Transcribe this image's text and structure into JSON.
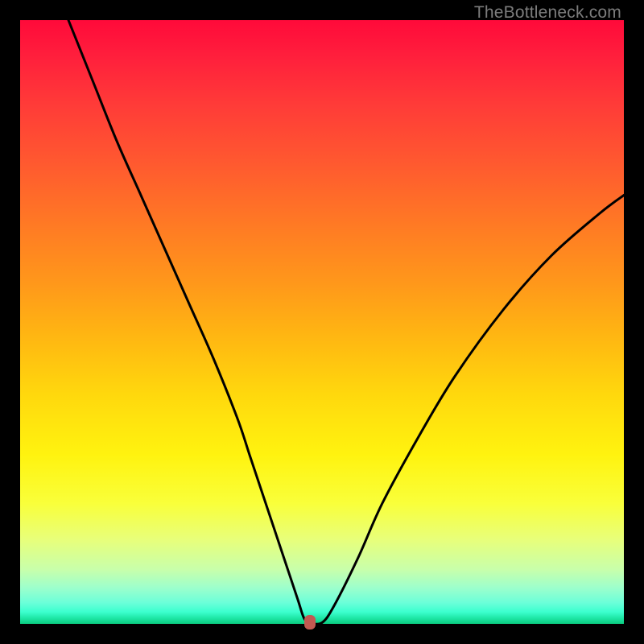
{
  "watermark": "TheBottleneck.com",
  "chart_data": {
    "type": "line",
    "title": "",
    "xlabel": "",
    "ylabel": "",
    "xlim": [
      0,
      100
    ],
    "ylim": [
      0,
      100
    ],
    "grid": false,
    "legend": false,
    "series": [
      {
        "name": "curve",
        "color": "#000000",
        "x": [
          8,
          12,
          16,
          20,
          24,
          28,
          32,
          36,
          38,
          40,
          42,
          44,
          46,
          47,
          48,
          50,
          52,
          56,
          60,
          66,
          72,
          80,
          88,
          96,
          100
        ],
        "y": [
          100,
          90,
          80,
          71,
          62,
          53,
          44,
          34,
          28,
          22,
          16,
          10,
          4,
          1,
          0.2,
          0.2,
          3,
          11,
          20,
          31,
          41,
          52,
          61,
          68,
          71
        ]
      }
    ],
    "marker": {
      "x": 48,
      "y": 0.3,
      "color": "#c25951"
    },
    "background_gradient": {
      "top": "#ff0a3a",
      "mid": "#fff30f",
      "bottom": "#0acb7f"
    }
  }
}
